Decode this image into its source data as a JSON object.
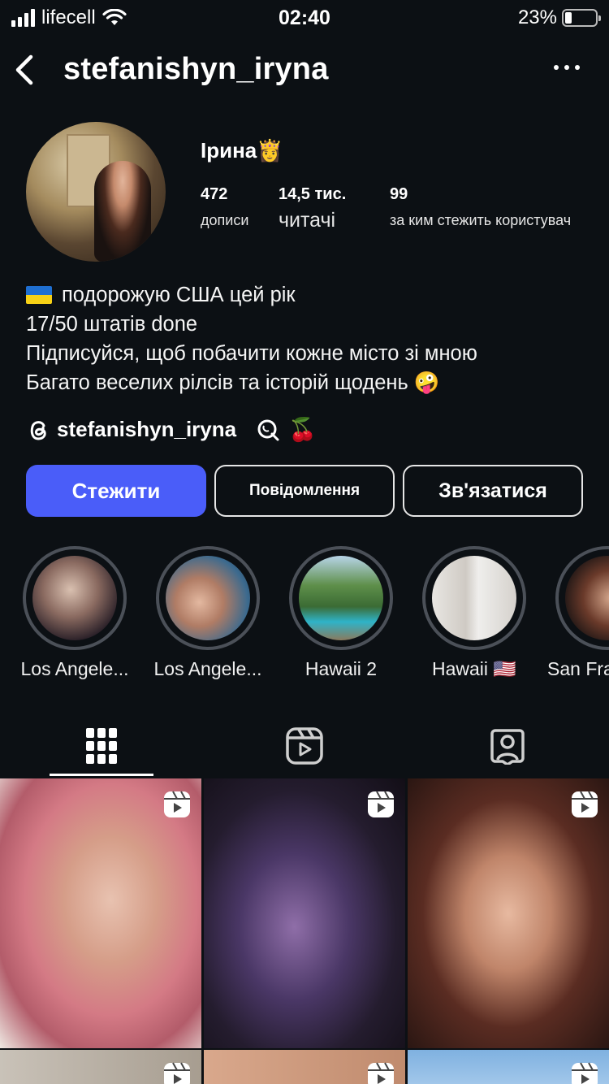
{
  "status_bar": {
    "carrier": "lifecell",
    "time": "02:40",
    "battery": "23%",
    "battery_level": 0.23
  },
  "header": {
    "username": "stefanishyn_iryna"
  },
  "profile": {
    "display_name": "Ірина👸",
    "stats": [
      {
        "value": "472",
        "label": "дописи"
      },
      {
        "value": "14,5 тис.",
        "label": "читачі"
      },
      {
        "value": "99",
        "label": "за ким стежить користувач"
      }
    ],
    "bio": [
      "подорожую США цей рік",
      "17/50 штатів done",
      "Підписуйся, щоб побачити кожне місто зі мною",
      "Багато веселих рілсів та історій щодень 🤪"
    ],
    "threads_handle": "stefanishyn_iryna",
    "threads_extra": "🍒"
  },
  "actions": {
    "follow": "Стежити",
    "message": "Повідомлення",
    "contact": "Зв'язатися"
  },
  "highlights": [
    {
      "label": "Los Angele..."
    },
    {
      "label": "Los Angele..."
    },
    {
      "label": "Hawaii 2"
    },
    {
      "label": "Hawaii 🇺🇸"
    },
    {
      "label": "San Fra"
    }
  ],
  "tabs": [
    "grid-icon",
    "reels-icon",
    "tagged-icon"
  ],
  "colors": {
    "background": "#0c1014",
    "accent": "#4a5df9"
  }
}
